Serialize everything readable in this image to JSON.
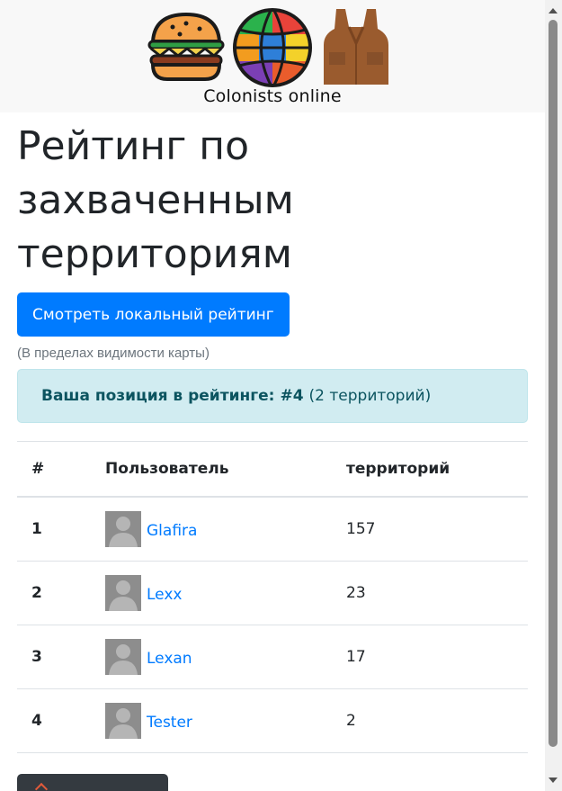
{
  "header": {
    "app_name": "Colonists online",
    "logo_icons": [
      "burger-icon",
      "globe-icon",
      "vest-icon"
    ]
  },
  "page": {
    "title": "Рейтинг по захваченным территориям",
    "local_button_label": "Смотреть локальный рейтинг",
    "local_hint": "(В пределах видимости карты)"
  },
  "position_alert": {
    "label": "Ваша позиция в рейтинге:",
    "position": "#4",
    "detail": "(2 территорий)"
  },
  "table": {
    "columns": [
      "#",
      "Пользователь",
      "территорий"
    ],
    "rows": [
      {
        "rank": "1",
        "user": "Glafira",
        "territories": "157"
      },
      {
        "rank": "2",
        "user": "Lexx",
        "territories": "23"
      },
      {
        "rank": "3",
        "user": "Lexan",
        "territories": "17"
      },
      {
        "rank": "4",
        "user": "Tester",
        "territories": "2"
      }
    ]
  },
  "colors": {
    "primary": "#007bff",
    "alert_bg": "#d1ecf1",
    "alert_text": "#0c5460",
    "header_bg": "#f8f8f8"
  }
}
